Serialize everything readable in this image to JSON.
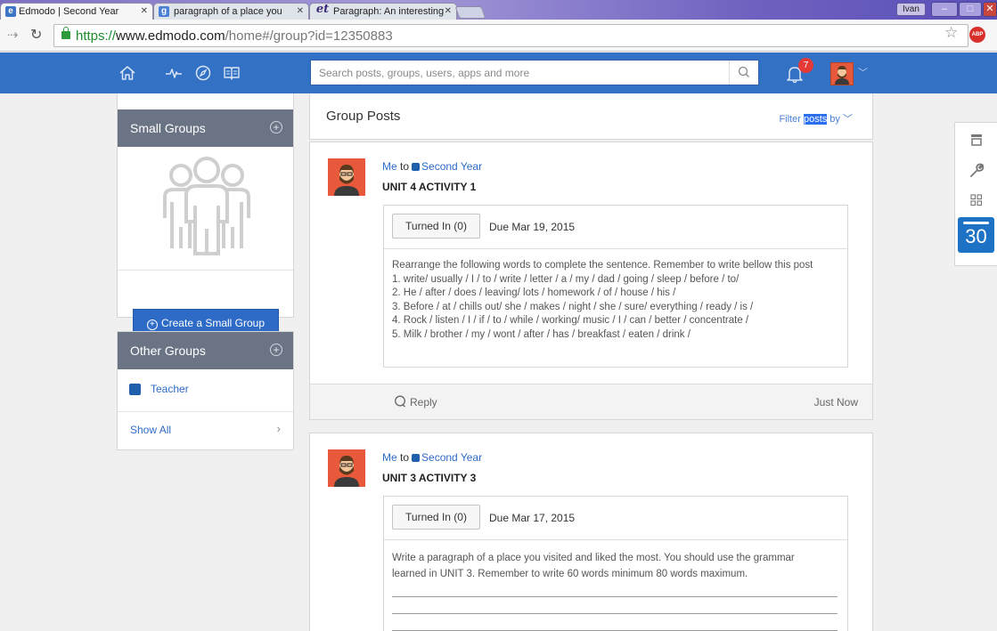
{
  "browser": {
    "tabs": [
      {
        "title": "Edmodo | Second Year",
        "favicon": "edmodo-favicon-icon"
      },
      {
        "title": "paragraph of a place you",
        "favicon": "google-favicon-icon"
      },
      {
        "title": "Paragraph: An interesting",
        "favicon": "et-favicon-icon"
      }
    ],
    "window_user": "Ivan",
    "url_scheme": "https://",
    "url_host": "www.edmodo.com",
    "url_rest": "/home#/group?id=12350883"
  },
  "header": {
    "search_placeholder": "Search posts, groups, users, apps and more",
    "notification_count": "7",
    "nav_icons": [
      "home-icon",
      "activity-icon",
      "discover-icon",
      "library-icon"
    ],
    "brand_color": "#3371c4"
  },
  "sidebar": {
    "small_groups": {
      "title": "Small Groups",
      "create_label": "Create a Small Group"
    },
    "other_groups": {
      "title": "Other Groups",
      "items": [
        {
          "label": "Teacher",
          "color": "#1f5fab"
        }
      ],
      "show_all": "Show All"
    }
  },
  "feed": {
    "title": "Group Posts",
    "filter": {
      "before": "Filter ",
      "highlight": "posts",
      "after": " by"
    },
    "posts": [
      {
        "sender": "Me",
        "to_word": "to",
        "group": "Second Year",
        "title": "UNIT 4 ACTIVITY 1",
        "turned_in": "Turned In (0)",
        "due": "Due Mar 19, 2015",
        "body_lines": [
          "Rearrange the following words to complete the sentence. Remember to write bellow this post",
          "1. write/ usually / I / to / write / letter / a / my / dad / going / sleep / before / to/",
          "2. He / after / does / leaving/ lots / homework / of / house / his /",
          "3. Before / at / chills out/ she / makes / night / she / sure/ everything / ready / is /",
          "4. Rock / listen / I / if / to / while / working/ music / I / can / better / concentrate /",
          "5. Milk / brother / my / wont / after / has / breakfast / eaten / drink /"
        ],
        "reply_label": "Reply",
        "timestamp": "Just Now"
      },
      {
        "sender": "Me",
        "to_word": "to",
        "group": "Second Year",
        "title": "UNIT 3 ACTIVITY 3",
        "turned_in": "Turned In (0)",
        "due": "Due Mar 17, 2015",
        "body_lines": [
          "Write a paragraph of a place you visited and liked the most. You should use the grammar",
          "learned in UNIT 3. Remember to write 60 words minimum 80 words maximum."
        ]
      }
    ]
  },
  "right_rail": {
    "icons": [
      "store-icon",
      "wrench-icon",
      "apps-grid-icon",
      "calendar-icon"
    ],
    "calendar_day": "30"
  }
}
